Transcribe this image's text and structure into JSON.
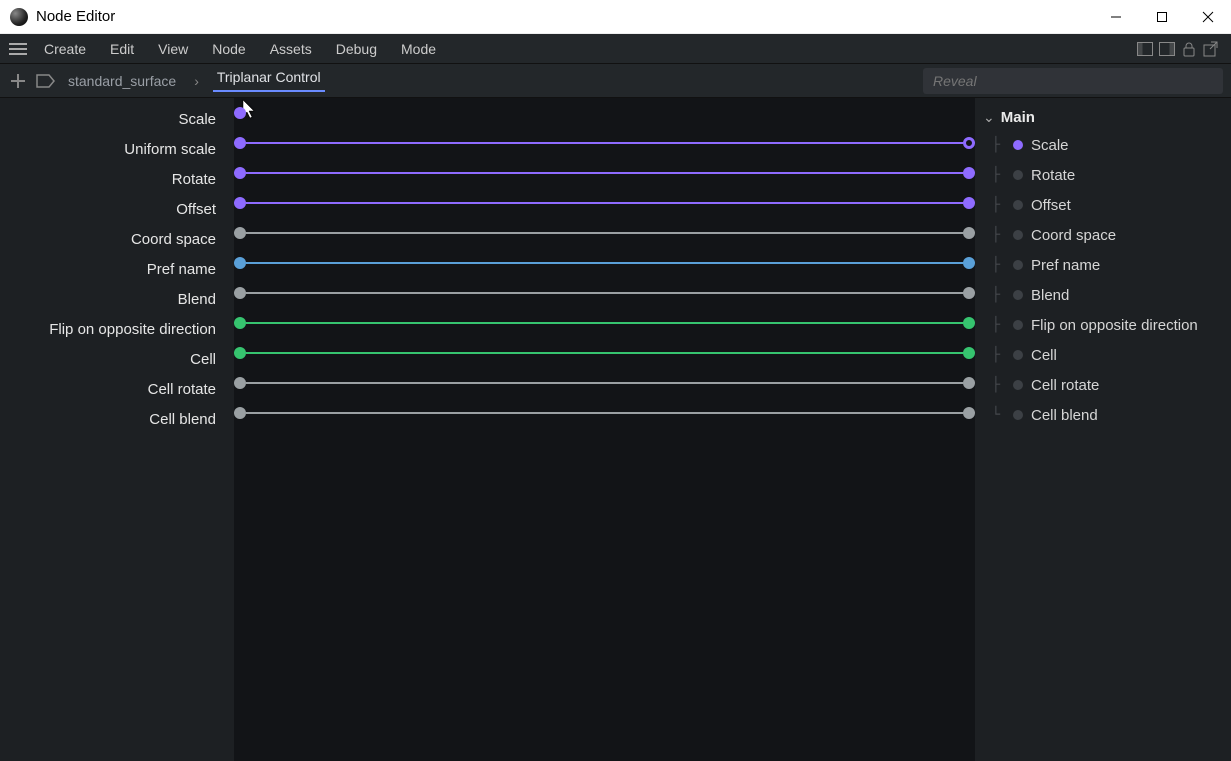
{
  "window": {
    "title": "Node Editor"
  },
  "menu": {
    "items": [
      "Create",
      "Edit",
      "View",
      "Node",
      "Assets",
      "Debug",
      "Mode"
    ]
  },
  "breadcrumb": {
    "root": "standard_surface",
    "current": "Triplanar Control"
  },
  "search": {
    "placeholder": "Reveal"
  },
  "colors": {
    "purple": "#8e6bff",
    "gray": "#9aa0a3",
    "blue": "#5aa0d8",
    "green": "#36c46f"
  },
  "params": [
    {
      "label": "Scale",
      "color": "purple",
      "half": true
    },
    {
      "label": "Uniform scale",
      "color": "purple",
      "ring": true
    },
    {
      "label": "Rotate",
      "color": "purple"
    },
    {
      "label": "Offset",
      "color": "purple"
    },
    {
      "label": "Coord space",
      "color": "gray"
    },
    {
      "label": "Pref name",
      "color": "blue"
    },
    {
      "label": "Blend",
      "color": "gray"
    },
    {
      "label": "Flip on opposite direction",
      "color": "green"
    },
    {
      "label": "Cell",
      "color": "green"
    },
    {
      "label": "Cell rotate",
      "color": "gray"
    },
    {
      "label": "Cell blend",
      "color": "gray"
    }
  ],
  "side": {
    "title": "Main",
    "items": [
      {
        "label": "Scale",
        "active": true
      },
      {
        "label": "Rotate"
      },
      {
        "label": "Offset"
      },
      {
        "label": "Coord space"
      },
      {
        "label": "Pref name"
      },
      {
        "label": "Blend"
      },
      {
        "label": "Flip on opposite direction"
      },
      {
        "label": "Cell"
      },
      {
        "label": "Cell rotate"
      },
      {
        "label": "Cell blend"
      }
    ]
  }
}
